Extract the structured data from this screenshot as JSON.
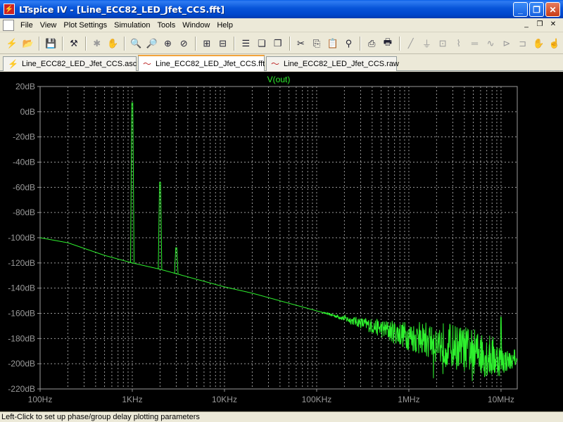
{
  "window": {
    "title": "LTspice IV - [Line_ECC82_LED_Jfet_CCS.fft]",
    "buttons": [
      "_",
      "❐",
      "✕"
    ]
  },
  "menu": {
    "items": [
      "File",
      "View",
      "Plot Settings",
      "Simulation",
      "Tools",
      "Window",
      "Help"
    ],
    "mdi_buttons": [
      "_",
      "❐",
      "✕"
    ]
  },
  "toolbar": {
    "icons": [
      {
        "name": "new-schematic-icon",
        "glyph": "⚡",
        "dim": false
      },
      {
        "name": "open-icon",
        "glyph": "📂",
        "dim": false
      },
      {
        "sep": true
      },
      {
        "name": "save-icon",
        "glyph": "💾",
        "dim": false
      },
      {
        "sep": true
      },
      {
        "name": "control-panel-icon",
        "glyph": "⚒",
        "dim": false
      },
      {
        "sep": true
      },
      {
        "name": "run-icon",
        "glyph": "✱",
        "dim": true
      },
      {
        "name": "halt-icon",
        "glyph": "✋",
        "dim": true
      },
      {
        "sep": true
      },
      {
        "name": "zoom-in-icon",
        "glyph": "🔍",
        "dim": false
      },
      {
        "name": "zoom-out-icon",
        "glyph": "🔎",
        "dim": false
      },
      {
        "name": "zoom-fit-icon",
        "glyph": "⊕",
        "dim": false
      },
      {
        "name": "zoom-cancel-icon",
        "glyph": "⊘",
        "dim": false
      },
      {
        "sep": true
      },
      {
        "name": "autorange-icon",
        "glyph": "⊞",
        "dim": false
      },
      {
        "name": "grid-icon",
        "glyph": "⊟",
        "dim": false
      },
      {
        "sep": true
      },
      {
        "name": "tile-horizontal-icon",
        "glyph": "☰",
        "dim": false
      },
      {
        "name": "cascade-icon",
        "glyph": "❏",
        "dim": false
      },
      {
        "name": "tile-vertical-icon",
        "glyph": "❐",
        "dim": false
      },
      {
        "sep": true
      },
      {
        "name": "cut-icon",
        "glyph": "✂",
        "dim": false
      },
      {
        "name": "copy-icon",
        "glyph": "⎘",
        "dim": false
      },
      {
        "name": "paste-icon",
        "glyph": "📋",
        "dim": false
      },
      {
        "name": "find-icon",
        "glyph": "⚲",
        "dim": false
      },
      {
        "sep": true
      },
      {
        "name": "print-setup-icon",
        "glyph": "⎙",
        "dim": false
      },
      {
        "name": "print-icon",
        "glyph": "🖶",
        "dim": false
      },
      {
        "sep": true
      },
      {
        "name": "wire-icon",
        "glyph": "╱",
        "dim": true
      },
      {
        "name": "ground-icon",
        "glyph": "⏚",
        "dim": true
      },
      {
        "name": "label-icon",
        "glyph": "⊡",
        "dim": true
      },
      {
        "name": "resistor-icon",
        "glyph": "⌇",
        "dim": true
      },
      {
        "name": "capacitor-icon",
        "glyph": "═",
        "dim": true
      },
      {
        "name": "inductor-icon",
        "glyph": "∿",
        "dim": true
      },
      {
        "name": "diode-icon",
        "glyph": "⊳",
        "dim": true
      },
      {
        "name": "component-icon",
        "glyph": "⊐",
        "dim": true
      },
      {
        "name": "move-icon",
        "glyph": "✋",
        "dim": true
      },
      {
        "name": "drag-icon",
        "glyph": "☝",
        "dim": true
      }
    ]
  },
  "tabs": [
    {
      "label": "Line_ECC82_LED_Jfet_CCS.asc",
      "icon": "schematic-icon",
      "glyph": "⚡",
      "active": false
    },
    {
      "label": "Line_ECC82_LED_Jfet_CCS.fft",
      "icon": "waveform-icon",
      "glyph": "〜",
      "active": true
    },
    {
      "label": "Line_ECC82_LED_Jfet_CCS.raw",
      "icon": "waveform-icon",
      "glyph": "〜",
      "active": false
    }
  ],
  "colors": {
    "plot_bg": "#000000",
    "grid": "#9a9a9a",
    "trace": "#2ef02e",
    "axis_text": "#9a9a9a"
  },
  "chart_data": {
    "type": "line",
    "title": "V(out)",
    "x_scale": "log",
    "xlim": [
      100,
      15000000
    ],
    "ylim": [
      -220,
      20
    ],
    "x_ticks": [
      {
        "value": 100,
        "label": "100Hz"
      },
      {
        "value": 1000,
        "label": "1KHz"
      },
      {
        "value": 10000,
        "label": "10KHz"
      },
      {
        "value": 100000,
        "label": "100KHz"
      },
      {
        "value": 1000000,
        "label": "1MHz"
      },
      {
        "value": 10000000,
        "label": "10MHz"
      }
    ],
    "y_ticks": [
      {
        "value": 20,
        "label": "20dB"
      },
      {
        "value": 0,
        "label": "0dB"
      },
      {
        "value": -20,
        "label": "-20dB"
      },
      {
        "value": -40,
        "label": "-40dB"
      },
      {
        "value": -60,
        "label": "-60dB"
      },
      {
        "value": -80,
        "label": "-80dB"
      },
      {
        "value": -100,
        "label": "-100dB"
      },
      {
        "value": -120,
        "label": "-120dB"
      },
      {
        "value": -140,
        "label": "-140dB"
      },
      {
        "value": -160,
        "label": "-160dB"
      },
      {
        "value": -180,
        "label": "-180dB"
      },
      {
        "value": -200,
        "label": "-200dB"
      },
      {
        "value": -220,
        "label": "-220dB"
      }
    ],
    "grid": true,
    "series": [
      {
        "name": "V(out)",
        "baseline": [
          [
            100,
            -100
          ],
          [
            200,
            -104
          ],
          [
            500,
            -114
          ],
          [
            1000,
            -120
          ],
          [
            2000,
            -125
          ],
          [
            5000,
            -133
          ],
          [
            10000,
            -139
          ],
          [
            20000,
            -144
          ],
          [
            50000,
            -152
          ],
          [
            100000,
            -158
          ],
          [
            200000,
            -164
          ],
          [
            500000,
            -172
          ],
          [
            1000000,
            -178
          ],
          [
            2000000,
            -183
          ],
          [
            5000000,
            -190
          ],
          [
            10000000,
            -197
          ],
          [
            15000000,
            -198
          ]
        ],
        "peaks": [
          {
            "x": 1000,
            "y": 7
          },
          {
            "x": 2000,
            "y": -56
          },
          {
            "x": 3000,
            "y": -108
          },
          {
            "x": 6000000,
            "y": -181
          },
          {
            "x": 7500000,
            "y": -185
          },
          {
            "x": 10000000,
            "y": -163
          },
          {
            "x": 14000000,
            "y": -189
          }
        ],
        "noise_floor": {
          "start_x": 100000,
          "max_spread_db": 18
        }
      }
    ]
  },
  "status": {
    "text": "Left-Click to set up phase/group delay plotting parameters"
  }
}
